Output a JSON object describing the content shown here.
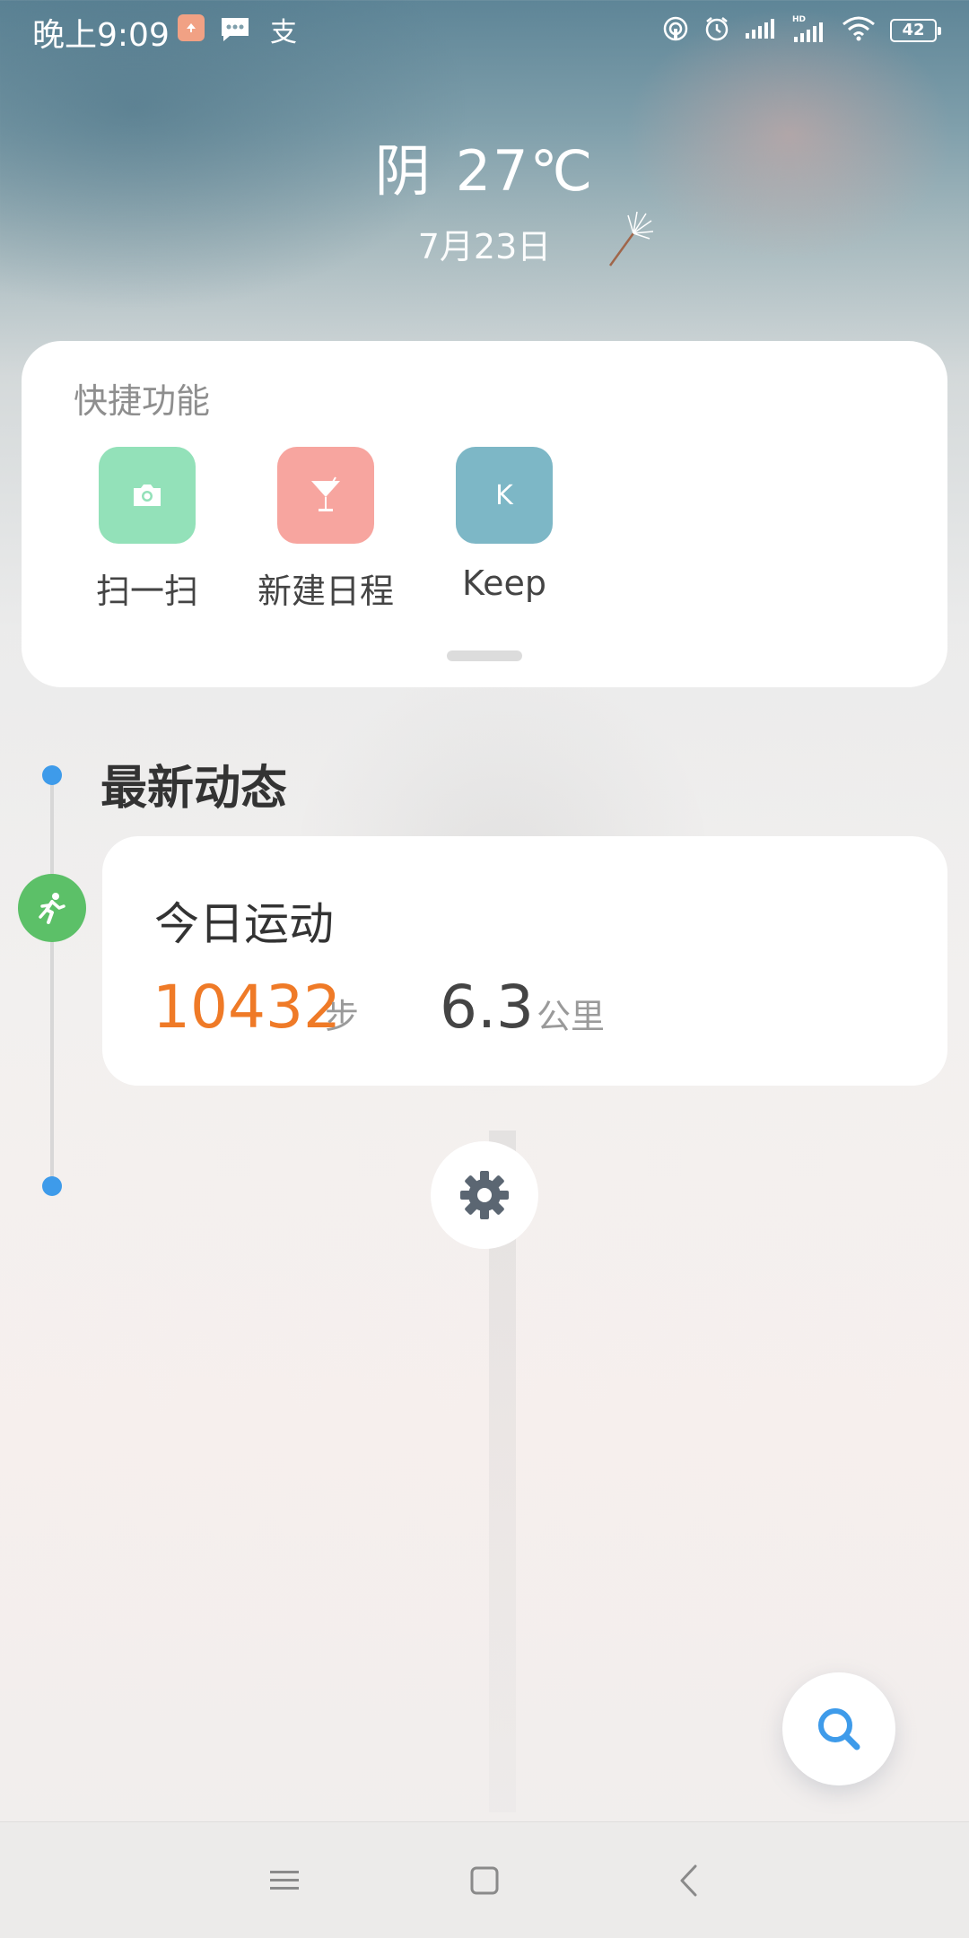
{
  "status_bar": {
    "time": "晚上9:09",
    "notif_pay_glyph": "支",
    "battery": "42",
    "icons": [
      "app-notification-icon",
      "message-icon",
      "alipay-icon",
      "hotspot-icon",
      "alarm-icon",
      "signal-icon",
      "hd-signal-icon",
      "wifi-icon",
      "battery-icon"
    ]
  },
  "weather": {
    "condition": "阴",
    "temperature": "27℃",
    "date": "7月23日"
  },
  "quick": {
    "title": "快捷功能",
    "items": [
      {
        "label": "扫一扫",
        "icon": "camera-icon",
        "color": "#93e1b9"
      },
      {
        "label": "新建日程",
        "icon": "cocktail-icon",
        "color": "#f7a59f"
      },
      {
        "label": "Keep",
        "icon": "keep-icon",
        "color": "#7db7c6",
        "glyph": "K"
      }
    ]
  },
  "feed": {
    "title": "最新动态",
    "sport": {
      "title": "今日运动",
      "steps": "10432",
      "steps_unit": "步",
      "distance": "6.3",
      "distance_unit": "公里"
    }
  },
  "colors": {
    "accent_blue": "#3e9bea",
    "steps_orange": "#ef7a27",
    "run_green": "#5cc068"
  }
}
